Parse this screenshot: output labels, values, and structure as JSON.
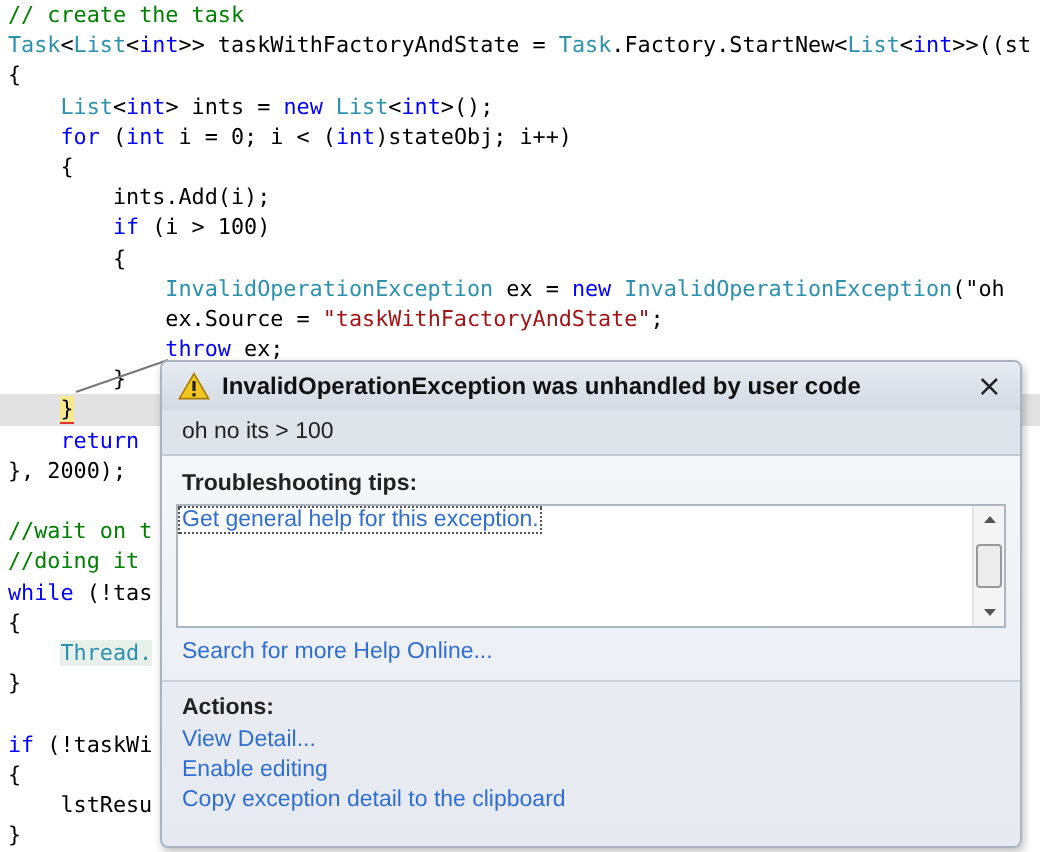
{
  "code_lines": [
    {
      "current": false,
      "indented": false,
      "tokens": [
        {
          "text": "// create the task",
          "kind": "comment"
        }
      ]
    },
    {
      "current": false,
      "indented": false,
      "tokens": [
        {
          "text": "Task",
          "kind": "type"
        },
        {
          "text": "<",
          "kind": "plain"
        },
        {
          "text": "List",
          "kind": "type"
        },
        {
          "text": "<",
          "kind": "plain"
        },
        {
          "text": "int",
          "kind": "keyword"
        },
        {
          "text": ">> taskWithFactoryAndState = ",
          "kind": "plain"
        },
        {
          "text": "Task",
          "kind": "type"
        },
        {
          "text": ".Factory.StartNew<",
          "kind": "plain"
        },
        {
          "text": "List",
          "kind": "type"
        },
        {
          "text": "<",
          "kind": "plain"
        },
        {
          "text": "int",
          "kind": "keyword"
        },
        {
          "text": ">>((st",
          "kind": "plain"
        }
      ]
    },
    {
      "current": false,
      "indented": false,
      "tokens": [
        {
          "text": "{",
          "kind": "plain"
        }
      ]
    },
    {
      "current": false,
      "indented": true,
      "tokens": [
        {
          "text": "List",
          "kind": "type"
        },
        {
          "text": "<",
          "kind": "plain"
        },
        {
          "text": "int",
          "kind": "keyword"
        },
        {
          "text": "> ints = ",
          "kind": "plain"
        },
        {
          "text": "new",
          "kind": "keyword"
        },
        {
          "text": " List",
          "kind": "type"
        },
        {
          "text": "<",
          "kind": "plain"
        },
        {
          "text": "int",
          "kind": "keyword"
        },
        {
          "text": ">();",
          "kind": "plain"
        }
      ]
    },
    {
      "current": false,
      "indented": true,
      "tokens": [
        {
          "text": "for",
          "kind": "keyword"
        },
        {
          "text": " (",
          "kind": "plain"
        },
        {
          "text": "int",
          "kind": "keyword"
        },
        {
          "text": " i = 0; i < (",
          "kind": "plain"
        },
        {
          "text": "int",
          "kind": "keyword"
        },
        {
          "text": ")stateObj; i++)",
          "kind": "plain"
        }
      ]
    },
    {
      "current": false,
      "indented": true,
      "tokens": [
        {
          "text": "{",
          "kind": "plain"
        }
      ]
    },
    {
      "current": false,
      "indented": true,
      "tokens": [
        {
          "text": "    ints.Add(i);",
          "kind": "plain"
        }
      ]
    },
    {
      "current": false,
      "indented": true,
      "tokens": [
        {
          "text": "    if",
          "kind": "keyword"
        },
        {
          "text": " (i > 100)",
          "kind": "plain"
        }
      ]
    },
    {
      "current": false,
      "indented": true,
      "tokens": [
        {
          "text": "    {",
          "kind": "plain"
        }
      ]
    },
    {
      "current": false,
      "indented": true,
      "tokens": [
        {
          "text": "        InvalidOperationException",
          "kind": "type"
        },
        {
          "text": " ex = ",
          "kind": "plain"
        },
        {
          "text": "new",
          "kind": "keyword"
        },
        {
          "text": " InvalidOperationException",
          "kind": "type"
        },
        {
          "text": "(\"oh",
          "kind": "plain"
        }
      ]
    },
    {
      "current": false,
      "indented": true,
      "tokens": [
        {
          "text": "        ex.Source = ",
          "kind": "plain"
        },
        {
          "text": "\"taskWithFactoryAndState\"",
          "kind": "string"
        },
        {
          "text": ";",
          "kind": "plain"
        }
      ]
    },
    {
      "current": false,
      "indented": true,
      "tokens": [
        {
          "text": "        throw",
          "kind": "keyword"
        },
        {
          "text": " ex;",
          "kind": "plain"
        }
      ]
    },
    {
      "current": false,
      "indented": true,
      "tokens": [
        {
          "text": "    }",
          "kind": "plain"
        }
      ]
    },
    {
      "current": true,
      "indented": true,
      "tokens": [
        {
          "text": "}",
          "kind": "statement"
        }
      ]
    },
    {
      "current": false,
      "indented": true,
      "tokens": [
        {
          "text": "return",
          "kind": "keyword"
        }
      ]
    },
    {
      "current": false,
      "indented": false,
      "tokens": [
        {
          "text": "}, 2000);",
          "kind": "plain"
        }
      ]
    },
    {
      "current": false
    },
    {
      "current": false,
      "indented": false,
      "tokens": [
        {
          "text": "//wait on t",
          "kind": "comment"
        }
      ]
    },
    {
      "current": false,
      "indented": false,
      "tokens": [
        {
          "text": "//doing it",
          "kind": "comment"
        }
      ]
    },
    {
      "current": false,
      "indented": false,
      "tokens": [
        {
          "text": "while",
          "kind": "keyword"
        },
        {
          "text": " (!tas",
          "kind": "plain"
        }
      ]
    },
    {
      "current": false,
      "indented": false,
      "tokens": [
        {
          "text": "{",
          "kind": "plain"
        }
      ]
    },
    {
      "current": false,
      "indented": true,
      "tokens": [
        {
          "text": "Thread.",
          "kind": "marked-type"
        }
      ]
    },
    {
      "current": false,
      "indented": false,
      "tokens": [
        {
          "text": "}",
          "kind": "plain"
        }
      ]
    },
    {
      "current": false
    },
    {
      "current": false,
      "indented": false,
      "tokens": [
        {
          "text": "if",
          "kind": "keyword"
        },
        {
          "text": " (!taskWi",
          "kind": "plain"
        }
      ]
    },
    {
      "current": false,
      "indented": false,
      "tokens": [
        {
          "text": "{",
          "kind": "plain"
        }
      ]
    },
    {
      "current": false,
      "indented": true,
      "tokens": [
        {
          "text": "lstResu",
          "kind": "plain"
        }
      ]
    },
    {
      "current": false,
      "indented": false,
      "tokens": [
        {
          "text": "}",
          "kind": "plain"
        }
      ]
    }
  ],
  "exception_popup": {
    "title": "InvalidOperationException was unhandled by user code",
    "close": "×",
    "message": "oh no its > 100",
    "tips_heading": "Troubleshooting tips:",
    "tips": [
      "Get general help for this exception."
    ],
    "search_link": "Search for more Help Online...",
    "actions_heading": "Actions:",
    "actions": [
      "View Detail...",
      "Enable editing",
      "Copy exception detail to the clipboard"
    ]
  }
}
